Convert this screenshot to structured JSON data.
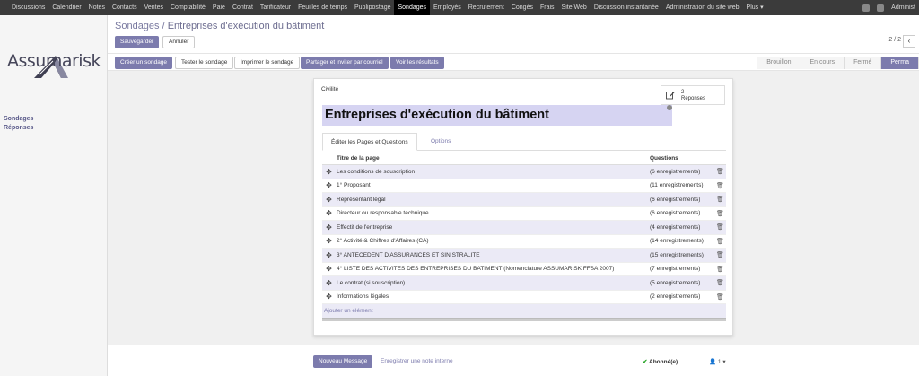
{
  "topnav": {
    "items": [
      "Discussions",
      "Calendrier",
      "Notes",
      "Contacts",
      "Ventes",
      "Comptabilité",
      "Paie",
      "Contrat",
      "Tarificateur",
      "Feuilles de temps",
      "Publipostage",
      "Sondages",
      "Employés",
      "Recrutement",
      "Congés",
      "Frais",
      "Site Web",
      "Discussion instantanée",
      "Administration du site web",
      "Plus ▾"
    ],
    "active_index": 11,
    "user": "Administ"
  },
  "sidebar": {
    "logo_text": "Assumarisk",
    "links": [
      "Sondages",
      "Réponses"
    ]
  },
  "header": {
    "breadcrumb_root": "Sondages",
    "breadcrumb_sep": " / ",
    "breadcrumb_current": "Entreprises d'exécution du bâtiment",
    "save_label": "Sauvegarder",
    "discard_label": "Annuler",
    "pager": "2 / 2",
    "pager_prev": "‹"
  },
  "toolbar": {
    "buttons": [
      "Créer un sondage",
      "Tester le sondage",
      "Imprimer le sondage",
      "Partager et inviter par courriel",
      "Voir les résultats"
    ],
    "stages": [
      "Brouillon",
      "En cours",
      "Fermé",
      "Perma"
    ],
    "active_stage": 3
  },
  "sheet": {
    "category": "Civilité",
    "stat_count": "2",
    "stat_label": "Réponses",
    "title": "Entreprises d'exécution du bâtiment",
    "tabs": [
      "Éditer les Pages et Questions",
      "Options"
    ],
    "table": {
      "headers": [
        "Titre de la page",
        "Questions"
      ],
      "rows": [
        {
          "title": "Les conditions de souscription",
          "questions": "(6 enregistrements)"
        },
        {
          "title": "1° Proposant",
          "questions": "(11 enregistrements)"
        },
        {
          "title": "Représentant légal",
          "questions": "(6 enregistrements)"
        },
        {
          "title": "Directeur ou responsable technique",
          "questions": "(6 enregistrements)"
        },
        {
          "title": "Effectif de l'entreprise",
          "questions": "(4 enregistrements)"
        },
        {
          "title": "2° Activité & Chiffres d'Affaires (CA)",
          "questions": "(14 enregistrements)"
        },
        {
          "title": "3° ANTECEDENT D'ASSURANCES ET SINISTRALITE",
          "questions": "(15 enregistrements)"
        },
        {
          "title": "4° LISTE DES ACTIVITES DES ENTREPRISES DU BATIMENT (Nomenclature ASSUMARISK FFSA 2007)",
          "questions": "(7 enregistrements)"
        },
        {
          "title": "Le contrat (si souscription)",
          "questions": "(5 enregistrements)"
        },
        {
          "title": "Informations légales",
          "questions": "(2 enregistrements)"
        }
      ],
      "add_label": "Ajouter un élément"
    }
  },
  "chatter": {
    "new_message": "Nouveau Message",
    "log_note": "Enregistrer une note interne",
    "follow": "Abonné(e)",
    "followers": "1"
  },
  "icons": {
    "drag": "drag-handle-icon",
    "delete": "trash-icon",
    "edit": "edit-icon"
  },
  "colors": {
    "primary": "#7c7bad",
    "nav_bg": "#3b3b3b",
    "title_bg": "#d6d4f2"
  }
}
